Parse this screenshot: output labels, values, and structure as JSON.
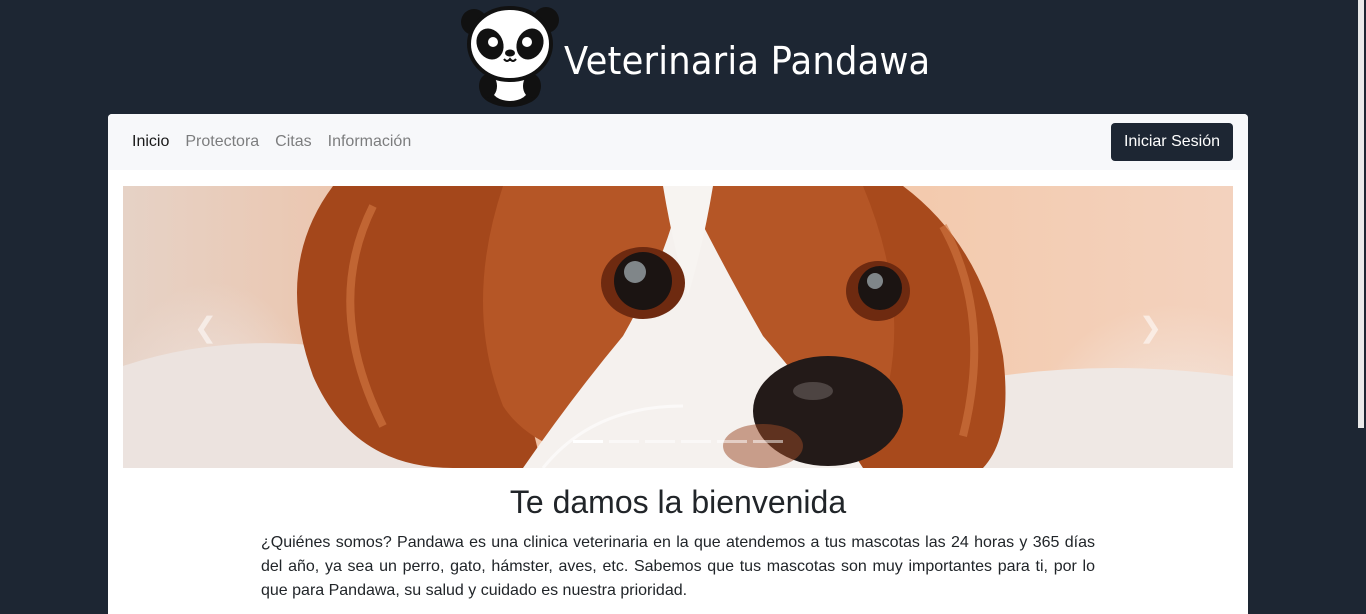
{
  "brand": {
    "title": "Veterinaria Pandawa",
    "logo_icon": "panda-logo-icon"
  },
  "nav": {
    "links": [
      {
        "label": "Inicio",
        "active": true
      },
      {
        "label": "Protectora",
        "active": false
      },
      {
        "label": "Citas",
        "active": false
      },
      {
        "label": "Información",
        "active": false
      }
    ],
    "login_label": "Iniciar Sesión"
  },
  "carousel": {
    "prev_icon": "chevron-left-icon",
    "next_icon": "chevron-right-icon",
    "slide_count": 6,
    "active_index": 0
  },
  "content": {
    "heading": "Te damos la bienvenida",
    "about": "¿Quiénes somos? Pandawa es una clinica veterinaria en la que atendemos a tus mascotas las 24 horas y 365 días del año, ya sea un perro, gato, hámster, aves, etc. Sabemos que tus mascotas son muy importantes para ti, por lo que para Pandawa, su salud y cuidado es nuestra prioridad."
  },
  "colors": {
    "background": "#1d2633",
    "navbar": "#f7f8fa",
    "button": "#1d2633"
  }
}
